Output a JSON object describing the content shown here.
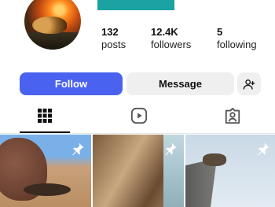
{
  "profile": {
    "avatar_icon": "profile-photo",
    "header_accent_color": "#1aa3a0"
  },
  "stats": {
    "posts": {
      "value": "132",
      "label": "posts"
    },
    "followers": {
      "value": "12.4K",
      "label": "followers"
    },
    "following": {
      "value": "5",
      "label": "following"
    }
  },
  "actions": {
    "follow_label": "Follow",
    "message_label": "Message",
    "add_user_icon": "add-user-icon",
    "follow_color": "#4a62f0"
  },
  "tabs": [
    {
      "icon": "grid-icon",
      "active": true
    },
    {
      "icon": "reels-icon",
      "active": false
    },
    {
      "icon": "tagged-icon",
      "active": false
    }
  ],
  "posts": [
    {
      "pinned": true,
      "icon": "pin-icon"
    },
    {
      "pinned": true,
      "icon": "pin-icon"
    },
    {
      "pinned": true,
      "icon": "pin-icon"
    }
  ]
}
